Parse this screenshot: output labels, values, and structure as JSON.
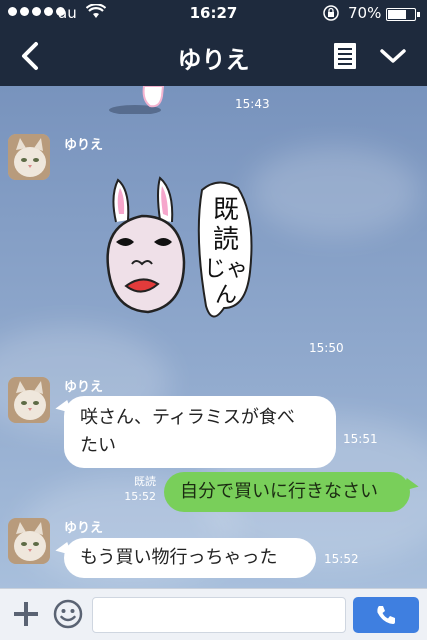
{
  "status_bar": {
    "carrier": "au",
    "time": "16:27",
    "battery": "70%",
    "battery_level": 0.7
  },
  "header": {
    "title": "ゆりえ",
    "back_icon": "chevron-left-icon",
    "memo_icon": "notes-icon",
    "menu_icon": "chevron-down-icon"
  },
  "messages": [
    {
      "type": "time",
      "time": "15:43"
    },
    {
      "type": "sticker",
      "sender": "ゆりえ",
      "sticker_text": "既読じゃん",
      "time": "15:50"
    },
    {
      "type": "incoming",
      "sender": "ゆりえ",
      "lines": [
        "咲さん、ティラミスが食べ",
        "たい"
      ],
      "time": "15:51"
    },
    {
      "type": "outgoing",
      "read": "既読",
      "time": "15:52",
      "text": "自分で買いに行きなさい"
    },
    {
      "type": "incoming",
      "sender": "ゆりえ",
      "text": "もう買い物行っちゃった",
      "time": "15:52"
    }
  ],
  "input_bar": {
    "plus_icon": "plus-icon",
    "emoji_icon": "smiley-icon",
    "message_value": "",
    "call_icon": "phone-icon"
  },
  "colors": {
    "nav": "#1e2a3d",
    "chat_bg": "#7f9ac2",
    "outgoing_bubble": "#79cf5a",
    "call_button": "#3f7fe0"
  }
}
